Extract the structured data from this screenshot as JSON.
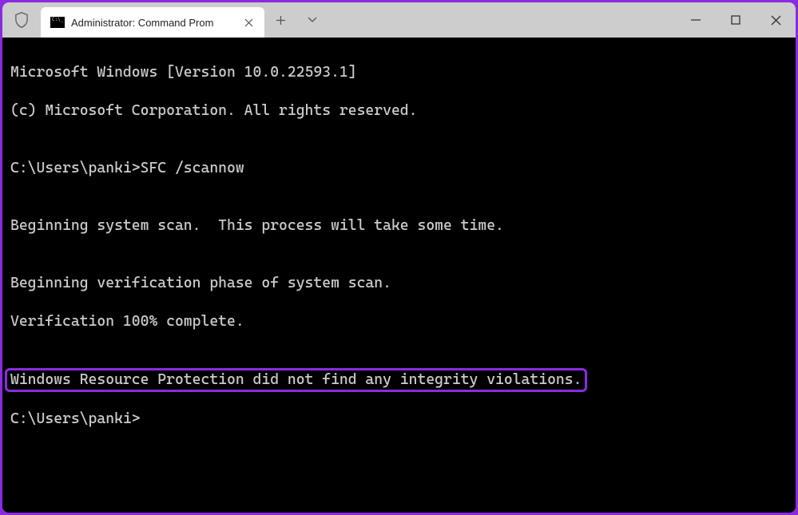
{
  "tab": {
    "title": "Administrator: Command Prom"
  },
  "terminal": {
    "line1": "Microsoft Windows [Version 10.0.22593.1]",
    "line2": "(c) Microsoft Corporation. All rights reserved.",
    "blank1": "",
    "prompt1": "C:\\Users\\panki>",
    "command1": "SFC /scannow",
    "blank2": "",
    "line3": "Beginning system scan.  This process will take some time.",
    "blank3": "",
    "line4": "Beginning verification phase of system scan.",
    "line5": "Verification 100% complete.",
    "blank4": "",
    "highlight": "Windows Resource Protection did not find any integrity violations.",
    "blank5": "",
    "prompt2": "C:\\Users\\panki>"
  }
}
